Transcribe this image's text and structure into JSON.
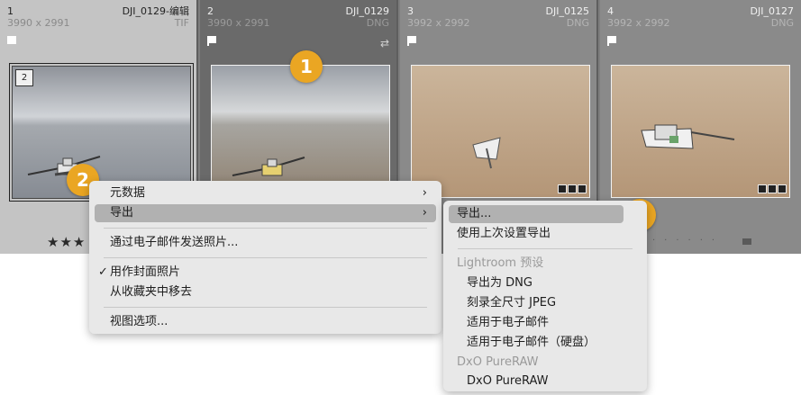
{
  "grid": {
    "cells": [
      {
        "index": "1",
        "filename": "DJI_0129-编辑",
        "dimensions": "3990 x 2991",
        "type": "TIF",
        "stack_count": "2",
        "rating": "★★★"
      },
      {
        "index": "2",
        "filename": "DJI_0129",
        "dimensions": "3990 x 2991",
        "type": "DNG"
      },
      {
        "index": "3",
        "filename": "DJI_0125",
        "dimensions": "3992 x 2992",
        "type": "DNG"
      },
      {
        "index": "4",
        "filename": "DJI_0127",
        "dimensions": "3992 x 2992",
        "type": "DNG"
      }
    ]
  },
  "callouts": {
    "one": "1",
    "two": "2",
    "three": "3"
  },
  "context_menu": {
    "metadata": "元数据",
    "export": "导出",
    "email": "通过电子邮件发送照片...",
    "cover": "用作封面照片",
    "remove_collection": "从收藏夹中移去",
    "view_options": "视图选项...",
    "checkmark": "✓",
    "submenu_arrow": "›"
  },
  "export_submenu": {
    "export": "导出...",
    "export_previous": "使用上次设置导出",
    "presets_header": "Lightroom 预设",
    "export_dng": "导出为 DNG",
    "burn_jpeg": "刻录全尺寸 JPEG",
    "for_email": "适用于电子邮件",
    "for_email_disk": "适用于电子邮件（硬盘）",
    "dxo_header": "DxO PureRAW",
    "dxo_item": "DxO PureRAW"
  },
  "colors": {
    "accent": "#eaa623",
    "highlight": "#b1b1b1"
  }
}
